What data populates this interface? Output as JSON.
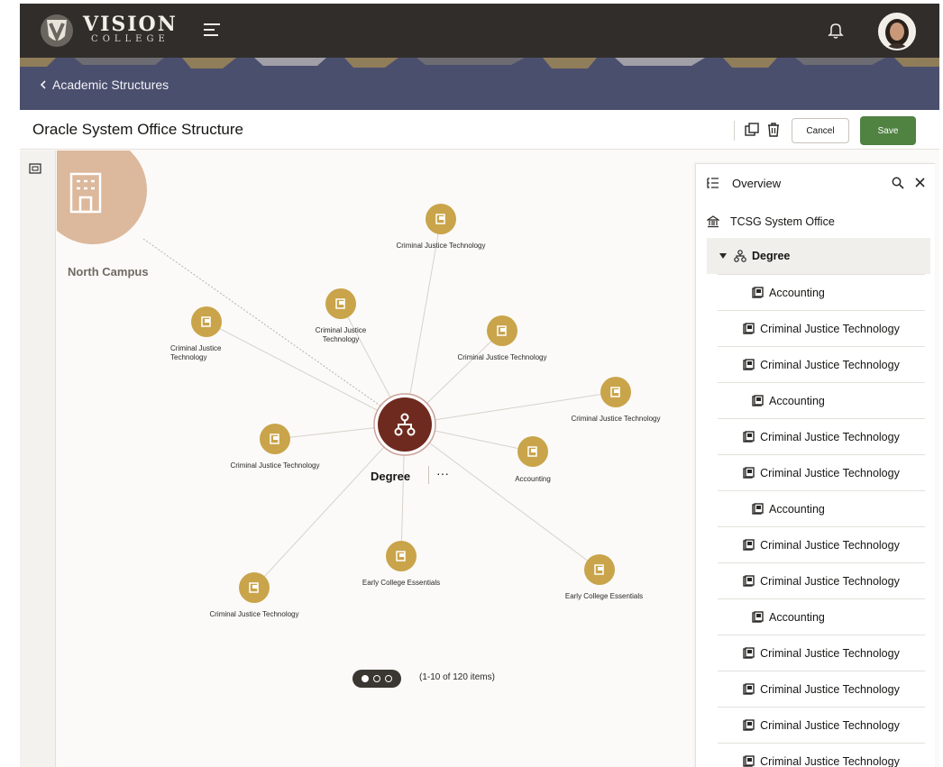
{
  "header": {
    "brand_main": "VISION",
    "brand_sub": "COLLEGE",
    "menu_icon": "hamburger-icon",
    "notification_icon": "bell-icon",
    "avatar_icon": "user-avatar"
  },
  "nav": {
    "back_label": "Academic Structures"
  },
  "titlebar": {
    "title": "Oracle System Office Structure",
    "cancel_label": "Cancel",
    "save_label": "Save",
    "save_color": "#508242"
  },
  "diagram": {
    "campus": "North Campus",
    "center": "Degree",
    "center_more": "···",
    "nodes": [
      {
        "label": "Criminal Justice Technology"
      },
      {
        "label": "Criminal Justice Technology"
      },
      {
        "label": "Criminal Justice Technology"
      },
      {
        "label": "Criminal Justice Technology"
      },
      {
        "label": "Criminal Justice Technology"
      },
      {
        "label": "Criminal Justice Technology"
      },
      {
        "label": "Accounting"
      },
      {
        "label": "Early College Essentials"
      },
      {
        "label": "Early College Essentials"
      },
      {
        "label": "Criminal Justice Technology"
      }
    ],
    "pager_text": "(1-10 of 120 items)",
    "accent_color": "#c9a44a",
    "center_color": "#6e2a1f"
  },
  "panel": {
    "title": "Overview",
    "root": "TCSG System Office",
    "group": "Degree",
    "items": [
      "Accounting",
      "Criminal Justice Technology",
      "Criminal Justice Technology",
      "Accounting",
      "Criminal Justice Technology",
      "Criminal Justice Technology",
      "Accounting",
      "Criminal Justice Technology",
      "Criminal Justice Technology",
      "Accounting",
      "Criminal Justice Technology",
      "Criminal Justice Technology",
      "Criminal Justice Technology",
      "Criminal Justice Technology"
    ]
  }
}
